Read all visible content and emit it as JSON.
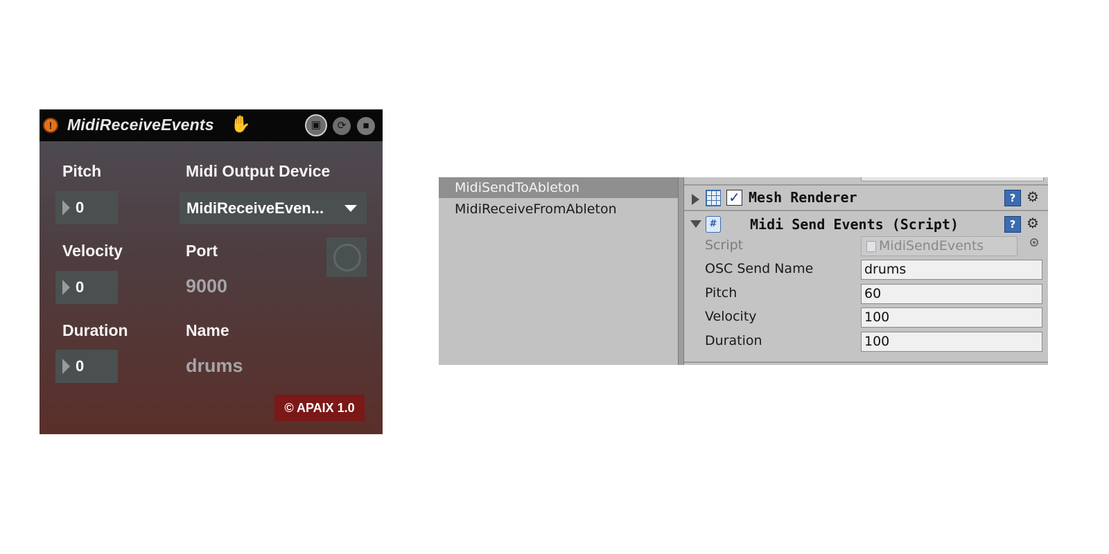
{
  "device": {
    "title": "MidiReceiveEvents",
    "warning_icon": "!",
    "pitch_label": "Pitch",
    "pitch_value": "0",
    "velocity_label": "Velocity",
    "velocity_value": "0",
    "duration_label": "Duration",
    "duration_value": "0",
    "output_device_label": "Midi Output Device",
    "output_device_value": "MidiReceiveEven...",
    "port_label": "Port",
    "port_value": "9000",
    "name_label": "Name",
    "name_value": "drums",
    "copyright": "© APAIX 1.0",
    "colors": {
      "titlebar": "#080808",
      "warning": "#e2731a",
      "hand": "#56a0ea",
      "badge": "#7b1818"
    }
  },
  "unity": {
    "hierarchy": {
      "items": [
        {
          "label": "MidiSendToAbleton",
          "selected": true
        },
        {
          "label": "MidiReceiveFromAbleton",
          "selected": false
        }
      ]
    },
    "mesh_renderer": {
      "title": "Mesh Renderer",
      "enabled": true
    },
    "midi_send_events": {
      "title": "Midi Send Events (Script)",
      "script": {
        "label": "Script",
        "value": "MidiSendEvents"
      },
      "osc_send_name": {
        "label": "OSC Send Name",
        "value": "drums"
      },
      "pitch": {
        "label": "Pitch",
        "value": "60"
      },
      "velocity": {
        "label": "Velocity",
        "value": "100"
      },
      "duration": {
        "label": "Duration",
        "value": "100"
      }
    },
    "colors": {
      "selection": "#8f8f8f",
      "panel": "#c2c2c2",
      "help": "#3a6cb0"
    }
  }
}
